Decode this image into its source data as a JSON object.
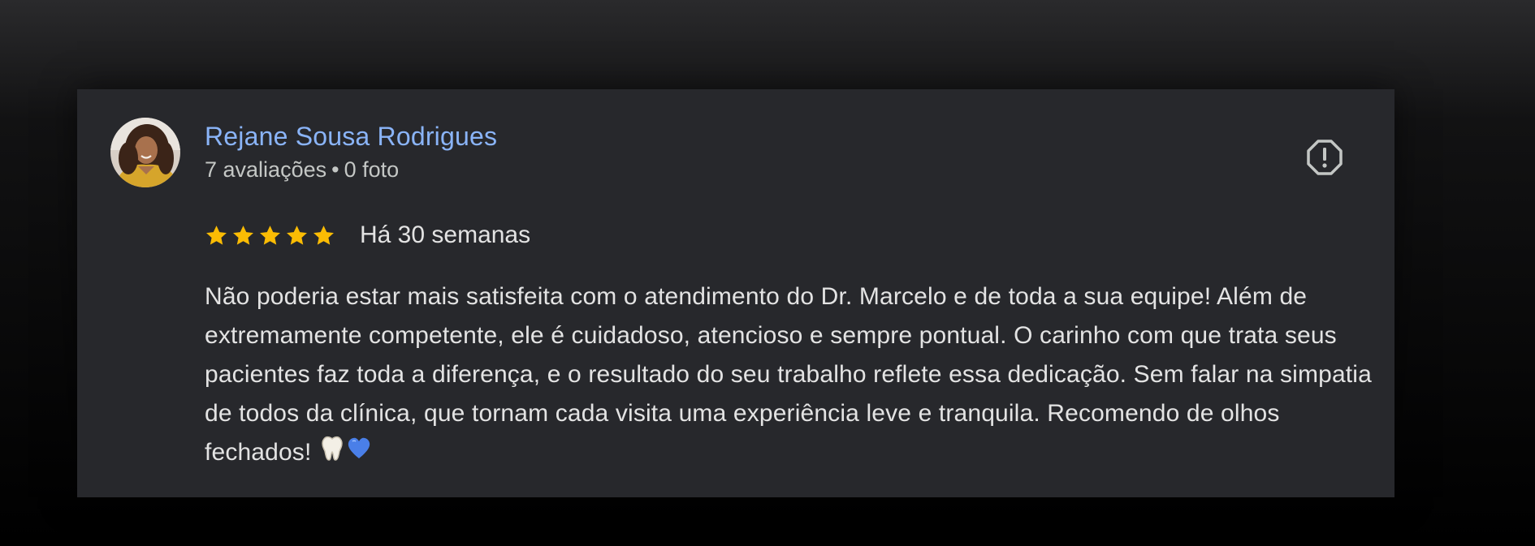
{
  "review": {
    "reviewer_name": "Rejane Sousa Rodrigues",
    "reviews_count": "7 avaliações",
    "separator": "•",
    "photos_count": "0 foto",
    "rating": 5,
    "rating_max": 5,
    "date": "Há 30 semanas",
    "text": "Não poderia estar mais satisfeita com o atendimento do Dr. Marcelo e de toda a sua equipe! Além de extremamente competente, ele é cuidadoso, atencioso e sempre pontual. O carinho com que trata seus pacientes faz toda a diferença, e o resultado do seu trabalho reflete essa dedicação. Sem falar na simpatia de todos da clínica, que tornam cada visita uma experiência leve e tranquila. Recomendo de olhos fechados!",
    "emojis": [
      "tooth-icon",
      "blue-heart-icon"
    ]
  },
  "colors": {
    "card_background": "#27282c",
    "name": "#8ab4f8",
    "star": "#fbbc04",
    "text": "#e3e3e3",
    "meta": "#c4c7c5",
    "flag_icon": "#c4c7c5"
  },
  "icons": {
    "flag": "report-icon",
    "star": "star-icon"
  }
}
